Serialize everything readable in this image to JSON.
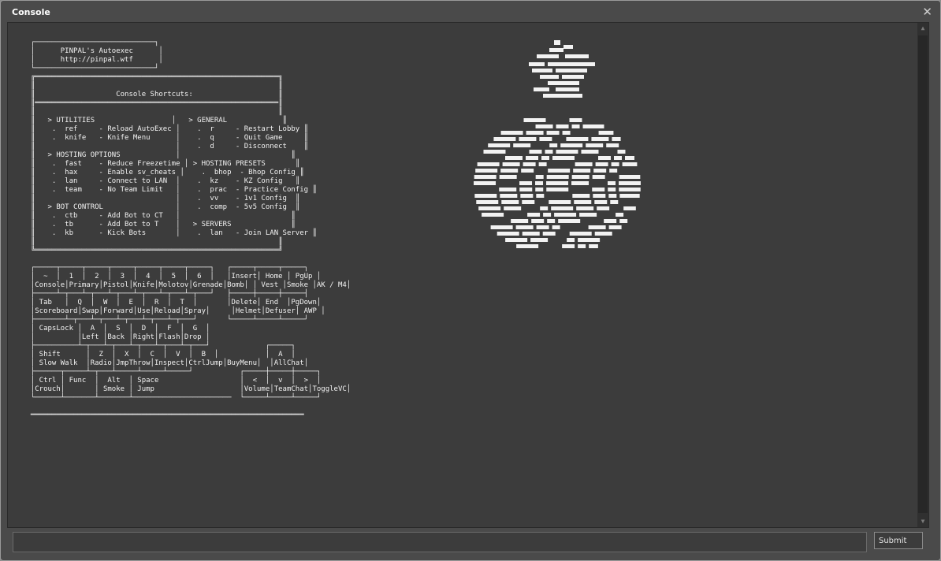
{
  "window": {
    "title": "Console",
    "close_glyph": "✕"
  },
  "console": {
    "lines": [
      "  ┌────────────────────────────┐",
      "  │      PINPAL's Autoexec      │",
      "  │      http://pinpal.wtf      │",
      "  └────────────────────────────┘",
      "  ╔═════════════════════════════════════════════════════════╗",
      "  ║                                                         ║",
      "  ║                   Console Shortcuts:                    ║",
      "  ║═════════════════════════════════════════════════════════║",
      "  ║                                                         ║",
      "  ║   > UTILITIES                  │   > GENERAL             ║",
      "  ║    .  ref     - Reload AutoExec │    .  r     - Restart Lobby ║",
      "  ║    .  knife   - Knife Menu      │    .  q     - Quit Game     ║",
      "  ║                                 │    .  d     - Disconnect    ║",
      "  ║   > HOSTING OPTIONS             │                          ║",
      "  ║    .  fast    - Reduce Freezetime │ > HOSTING PRESETS       ║",
      "  ║    .  hax     - Enable sv_cheats │    .  bhop  - Bhop Config ║",
      "  ║    .  lan     - Connect to LAN  │    .  kz    - KZ Config   ║",
      "  ║    .  team    - No Team Limit   │    .  prac  - Practice Config ║",
      "  ║                                 │    .  vv    - 1v1 Config  ║",
      "  ║   > BOT CONTROL                 │    .  comp  - 5v5 Config  ║",
      "  ║    .  ctb     - Add Bot to CT   │                          ║",
      "  ║    .  tb      - Add Bot to T    │   > SERVERS              ║",
      "  ║    .  kb      - Kick Bots       │    .  lan   - Join LAN Server ║",
      "  ║                                                         ║",
      "  ╚═════════════════════════════════════════════════════════╝",
      "",
      "  ┌─────┬─────┬─────┬─────┬─────┬─────┬─────┐   ┌─────┬─────┬─────┐",
      "  │  ~  │  1  │  2  │  3  │  4  │  5  │  6  │   │Insert│ Home │ PgUp │",
      "  │Console│Primary│Pistol│Knife│Molotov│Grenade│Bomb│ │ Vest │Smoke │AK / M4│",
      "  ├─────┴─┬───┴─┬───┴─┬───┴─┬───┴─┬───┴─┬───┘   ├─────┼─────┼─────┤",
      "  │ Tab   │  Q  │  W  │  E  │  R  │  T  │       │Delete│ End  │PgDown│",
      "  │Scoreboard│Swap│Forward│Use│Reload│Spray│     │Helmet│Defuser│ AWP │",
      "  ├───────┴─┬───┴─┬───┴─┬───┴─┬───┴─┬───┘       └─────┴─────┴─────┘",
      "  │ CapsLock │  A  │  S  │  D  │  F  │  G  │",
      "  │          │Left │Back │Right│Flash│Drop │",
      "  ├──────────┴─┬───┴─┬───┴─┬───┴─┬───┴─┬───┘             ┌─────┐",
      "  │ Shift      │  Z  │  X  │  C  │  V  │  B  │           │  A  │",
      "  │ Slow Walk  │Radio│JmpThrow│Inspect│CtrlJump│BuyMenu│  │AllChat│",
      "  ├──────┬─────┴─┬───┴─────┴─────┴─────┘           ┌─────┼─────┼─────┐",
      "  │ Ctrl │ Func  │  Alt  │ Space                   │  <  │  v  │  >  │",
      "  │Crouch│       │ Smoke │ Jump                    │Volume│TeamChat│ToggleVC│",
      "  └──────┴───────┴───────┴───────────────────────  └─────┴─────┴─────┘",
      "",
      "  ════════════════════════════════════════════════════════════════"
    ]
  },
  "input": {
    "value": "",
    "placeholder": ""
  },
  "submit_label": "Submit",
  "colors": {
    "console_bg": "#3c3c3c",
    "text": "#f2f2f2",
    "window_bg": "#4a4a4a"
  },
  "icons": {
    "close": "close-icon",
    "logo": "pineapple-ascii-art"
  }
}
